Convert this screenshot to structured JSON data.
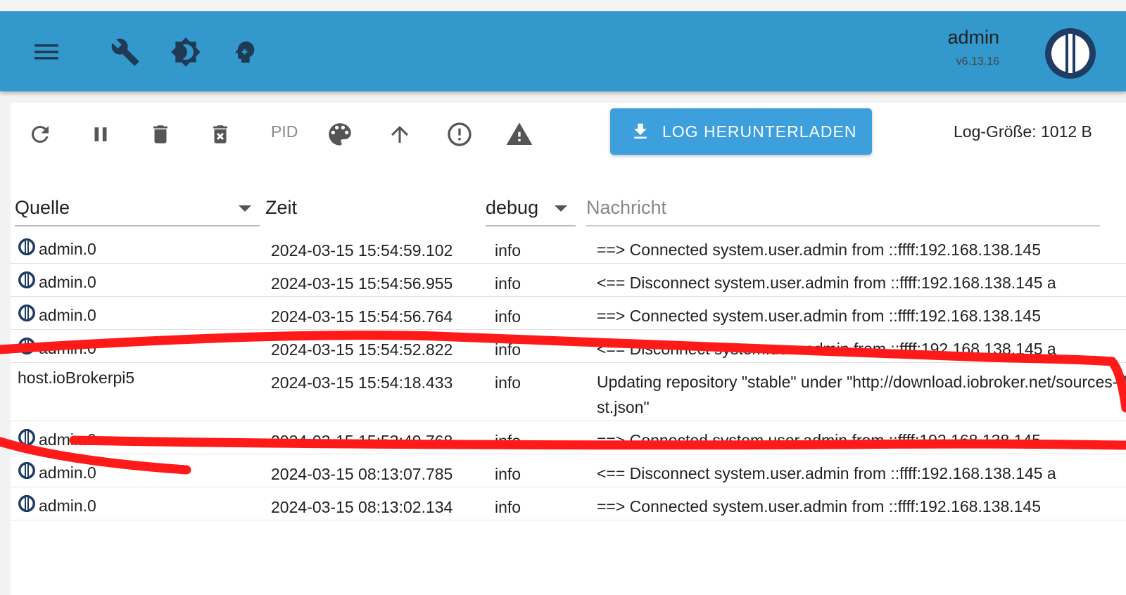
{
  "appbar": {
    "icons": [
      "menu-icon",
      "wrench-icon",
      "brightness-icon",
      "expert-mode-icon"
    ],
    "user_name": "admin",
    "version": "v6.13.16",
    "logo": "iobroker-logo"
  },
  "toolbar": {
    "icons": [
      "refresh-icon",
      "pause-icon",
      "delete-icon",
      "delete-forever-icon",
      "palette-icon",
      "arrow-up-icon",
      "error-icon",
      "warning-icon"
    ],
    "pid_label": "PID",
    "download_label": "LOG HERUNTERLADEN",
    "log_size": "Log-Größe: 1012 B"
  },
  "columns": {
    "source": "Quelle",
    "time": "Zeit",
    "level": "debug",
    "message": "Nachricht"
  },
  "rows": [
    {
      "source": "admin.0",
      "time": "2024-03-15 15:54:59.102",
      "level": "info",
      "message": "==> Connected system.user.admin from ::ffff:192.168.138.145"
    },
    {
      "source": "admin.0",
      "time": "2024-03-15 15:54:56.955",
      "level": "info",
      "message": "<== Disconnect system.user.admin from ::ffff:192.168.138.145 a"
    },
    {
      "source": "admin.0",
      "time": "2024-03-15 15:54:56.764",
      "level": "info",
      "message": "==> Connected system.user.admin from ::ffff:192.168.138.145"
    },
    {
      "source": "admin.0",
      "time": "2024-03-15 15:54:52.822",
      "level": "info",
      "message": "<== Disconnect system.user.admin from ::ffff:192.168.138.145 a"
    },
    {
      "source": "host.ioBrokerpi5",
      "time": "2024-03-15 15:54:18.433",
      "level": "info",
      "message": "Updating repository \"stable\" under \"http://download.iobroker.net/sources-dist.json\""
    },
    {
      "source": "admin.0",
      "time": "2024-03-15 15:53:49.768",
      "level": "info",
      "message": "==> Connected system.user.admin from ::ffff:192.168.138.145"
    },
    {
      "source": "admin.0",
      "time": "2024-03-15 08:13:07.785",
      "level": "info",
      "message": "<== Disconnect system.user.admin from ::ffff:192.168.138.145 a"
    },
    {
      "source": "admin.0",
      "time": "2024-03-15 08:13:02.134",
      "level": "info",
      "message": "==> Connected system.user.admin from ::ffff:192.168.138.145"
    }
  ],
  "colors": {
    "appbar": "#3399cc",
    "button": "#3da0dc",
    "scribble": "#ff1a1a"
  }
}
